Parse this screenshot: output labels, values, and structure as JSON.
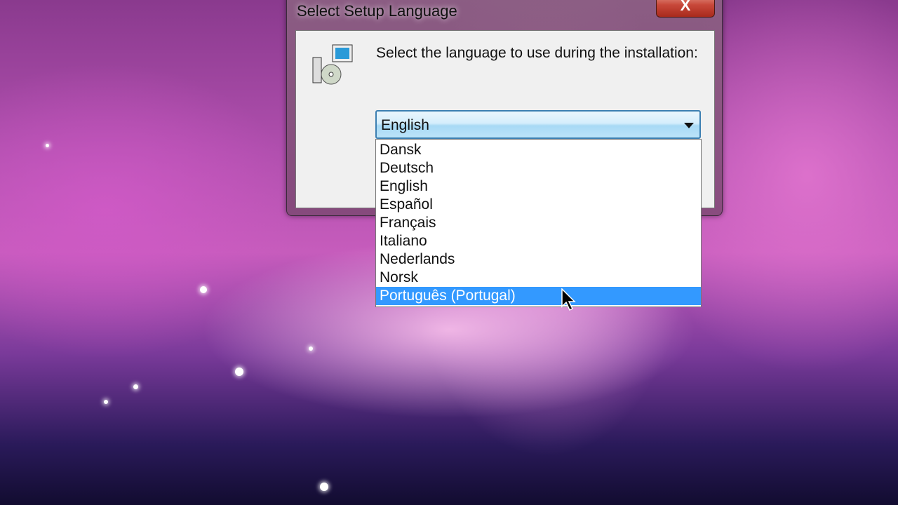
{
  "dialog": {
    "title": "Select Setup Language",
    "close_label": "X",
    "prompt": "Select the language to use during the installation:"
  },
  "combo": {
    "selected": "English"
  },
  "list": {
    "items": [
      "Dansk",
      "Deutsch",
      "English",
      "Español",
      "Français",
      "Italiano",
      "Nederlands",
      "Norsk",
      "Português (Portugal)"
    ],
    "highlighted": "Português (Portugal)"
  },
  "colors": {
    "highlight": "#3399ff"
  }
}
